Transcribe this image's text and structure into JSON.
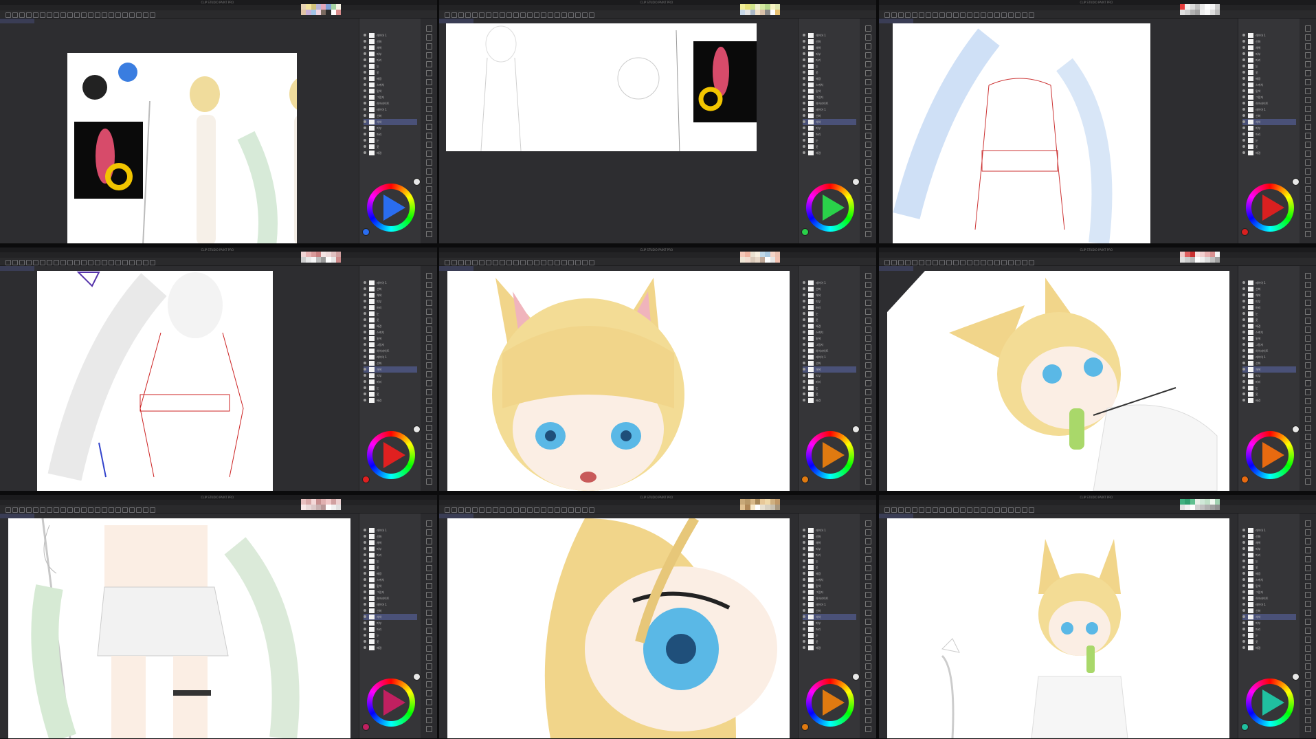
{
  "app": {
    "window_title": "CLIP STUDIO PAINT PRO",
    "menu_items": [
      "File",
      "Edit",
      "Animation",
      "Layer",
      "Select",
      "View",
      "Filter",
      "Window",
      "Help"
    ],
    "active_tab": "Canvas"
  },
  "panels": [
    {
      "id": 1,
      "canvas_kind": "lineup",
      "wheel_color": "#2a6df0",
      "palette": [
        "#e8d3b4",
        "#f3e39e",
        "#d2c27a",
        "#b9b5d8",
        "#e3a6b8",
        "#7b9fd6",
        "#a7d3a2",
        "#f7f2e4",
        "#e0c4a6",
        "#c9b0d9",
        "#a1c4e6",
        "#f2d5df",
        "#7a6a60",
        "#2b2b2b",
        "#ffffff",
        "#d98c8c"
      ]
    },
    {
      "id": 2,
      "canvas_kind": "sketch",
      "wheel_color": "#2ad14a",
      "palette": [
        "#f2ef9a",
        "#e6e27a",
        "#cfe28a",
        "#f0f0d0",
        "#d4e9a0",
        "#b6d88a",
        "#f7f4c2",
        "#e0e8b0",
        "#c8d8e8",
        "#e4e4e4",
        "#aab8c8",
        "#f0e0c8",
        "#d8c0a8",
        "#888",
        "#fff",
        "#e8c070"
      ]
    },
    {
      "id": 3,
      "canvas_kind": "blue-lines",
      "wheel_color": "#d92020",
      "palette": [
        "#e63b3b",
        "#f0f0f0",
        "#dcdcdc",
        "#c0c0c0",
        "#e9e9e9",
        "#ffffff",
        "#f5f5f5",
        "#cccccc",
        "#e0e0e0",
        "#d0d0d0",
        "#b0b0b0",
        "#a0a0a0",
        "#eeeeee",
        "#f8f8f8",
        "#dddddd",
        "#bbbbbb"
      ]
    },
    {
      "id": 4,
      "canvas_kind": "red-lines",
      "wheel_color": "#e02020",
      "palette": [
        "#f2d6d6",
        "#e8b4b4",
        "#d99a9a",
        "#c98080",
        "#f4e4e4",
        "#eedada",
        "#e0c0c0",
        "#d0a0a0",
        "#cfcfcf",
        "#e9e9e9",
        "#f6f6f6",
        "#bbbbbb",
        "#999999",
        "#ffffff",
        "#e8e8e8",
        "#cc8888"
      ]
    },
    {
      "id": 5,
      "canvas_kind": "face-closeup",
      "wheel_color": "#e07a10",
      "palette": [
        "#f6c8b8",
        "#f0b4a0",
        "#e9e0d0",
        "#f7efe0",
        "#c0d8e8",
        "#a8c8e0",
        "#f4d4c8",
        "#eac0b0",
        "#efe6d6",
        "#f2ddd0",
        "#d9c9b9",
        "#e8d8c8",
        "#bfa898",
        "#ffffff",
        "#e6e6e6",
        "#f0c0b0"
      ]
    },
    {
      "id": 6,
      "canvas_kind": "popsicle",
      "wheel_color": "#e86a10",
      "palette": [
        "#f0c8c8",
        "#e06060",
        "#c83030",
        "#f8e0e0",
        "#f2d0d0",
        "#e8b0b0",
        "#d89090",
        "#f4f4f4",
        "#e0e0e0",
        "#cccccc",
        "#b8b8b8",
        "#ffffff",
        "#f0f0f0",
        "#dcdcdc",
        "#c0c0c0",
        "#a0a0a0"
      ]
    },
    {
      "id": 7,
      "canvas_kind": "body",
      "wheel_color": "#c02060",
      "palette": [
        "#e8c0c0",
        "#d8a8a8",
        "#f4d8d8",
        "#c89090",
        "#e0b0b0",
        "#f0c8c8",
        "#d0a0a0",
        "#ecd0d0",
        "#f8e8e8",
        "#e8d8d8",
        "#dcc8c8",
        "#c8b0b0",
        "#b89898",
        "#ffffff",
        "#f0f0f0",
        "#e0e0e0"
      ]
    },
    {
      "id": 8,
      "canvas_kind": "eye-closeup",
      "wheel_color": "#e07a10",
      "palette": [
        "#c8a878",
        "#b89868",
        "#d8b888",
        "#a88858",
        "#e8c898",
        "#f0d8a8",
        "#d0b080",
        "#c09868",
        "#e0c090",
        "#b08858",
        "#f8e8c8",
        "#ffffff",
        "#e8e0d0",
        "#d8d0c0",
        "#c8c0b0",
        "#a89880"
      ]
    },
    {
      "id": 9,
      "canvas_kind": "fullbody",
      "wheel_color": "#20c0a0",
      "palette": [
        "#40b080",
        "#30a070",
        "#60c090",
        "#e8f0e8",
        "#d0e8d8",
        "#c0e0c8",
        "#f0f8f0",
        "#a0d0b0",
        "#e0e0e0",
        "#f0f0f0",
        "#ffffff",
        "#d0d0d0",
        "#c0c0c0",
        "#b0b0b0",
        "#a0a0a0",
        "#909090"
      ]
    }
  ],
  "layer_names": [
    "레이어 1",
    "선화",
    "채색",
    "피부",
    "머리",
    "눈",
    "옷",
    "배경",
    "스케치",
    "밑색",
    "그림자",
    "하이라이트"
  ]
}
